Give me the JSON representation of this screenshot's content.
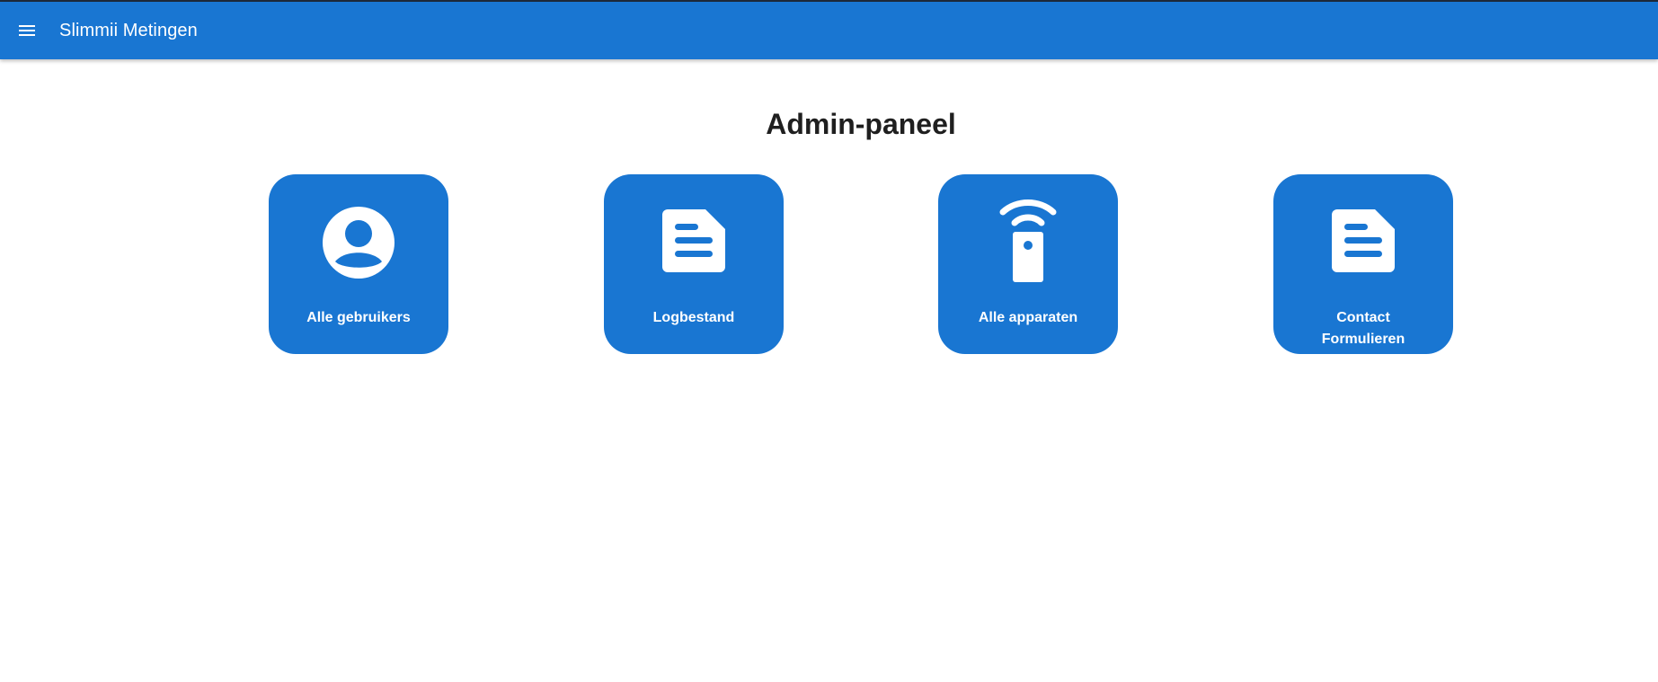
{
  "appbar": {
    "title": "Slimmii Metingen",
    "menu_icon": "menu-icon",
    "color": "#1976d2"
  },
  "main": {
    "title": "Admin-paneel",
    "tiles": [
      {
        "label": "Alle gebruikers",
        "icon": "account-circle-icon"
      },
      {
        "label": "Logbestand",
        "icon": "document-icon"
      },
      {
        "label": "Alle apparaten",
        "icon": "remote-device-icon"
      },
      {
        "label": "Contact Formulieren",
        "icon": "document-icon"
      }
    ]
  }
}
